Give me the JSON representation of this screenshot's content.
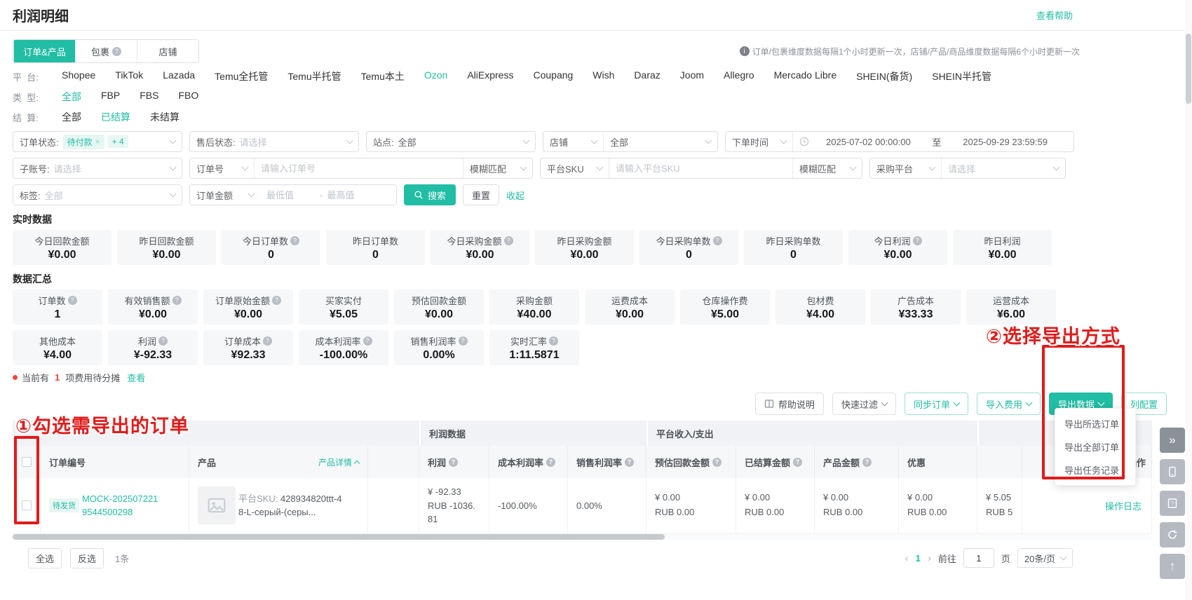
{
  "page": {
    "title": "利润明细",
    "help_link": "查看帮助",
    "update_note": "订单/包裹维度数据每隔1个小时更新一次，店铺/产品/商品维度数据每隔6个小时更新一次"
  },
  "tabs": [
    {
      "label": "订单&产品",
      "active": true
    },
    {
      "label": "包裹",
      "active": false,
      "info": true
    },
    {
      "label": "店铺",
      "active": false
    }
  ],
  "platform_filter": {
    "label": "平  台:",
    "items": [
      {
        "label": "Shopee"
      },
      {
        "label": "TikTok"
      },
      {
        "label": "Lazada"
      },
      {
        "label": "Temu全托管"
      },
      {
        "label": "Temu半托管"
      },
      {
        "label": "Temu本土"
      },
      {
        "label": "Ozon",
        "active": true
      },
      {
        "label": "AliExpress"
      },
      {
        "label": "Coupang"
      },
      {
        "label": "Wish"
      },
      {
        "label": "Daraz"
      },
      {
        "label": "Joom"
      },
      {
        "label": "Allegro"
      },
      {
        "label": "Mercado Libre"
      },
      {
        "label": "SHEIN(备货)"
      },
      {
        "label": "SHEIN半托管"
      }
    ]
  },
  "type_filter": {
    "label": "类  型:",
    "items": [
      {
        "label": "全部",
        "active": true
      },
      {
        "label": "FBP"
      },
      {
        "label": "FBS"
      },
      {
        "label": "FBO"
      }
    ]
  },
  "settle_filter": {
    "label": "结  算:",
    "items": [
      {
        "label": "全部"
      },
      {
        "label": "已结算",
        "active": true
      },
      {
        "label": "未结算"
      }
    ]
  },
  "filters": {
    "order_status": {
      "label": "订单状态:",
      "tag": "待付款",
      "tag_close": "×",
      "more": "+ 4"
    },
    "after_sale": {
      "label": "售后状态:",
      "placeholder": "请选择"
    },
    "site": {
      "label": "站点:",
      "value": "全部"
    },
    "shop": {
      "left": "店铺",
      "value": "全部"
    },
    "order_time": {
      "left": "下单时间",
      "start": "2025-07-02 00:00:00",
      "to": "至",
      "end": "2025-09-29 23:59:59"
    },
    "sub_account": {
      "label": "子账号:",
      "placeholder": "请选择"
    },
    "order_no": {
      "left": "订单号",
      "placeholder": "请输入订单号",
      "match": "模糊匹配"
    },
    "platform_sku": {
      "left": "平台SKU",
      "placeholder": "请输入平台SKU",
      "match": "模糊匹配"
    },
    "purchase_platform": {
      "left": "采购平台",
      "placeholder": "请选择"
    },
    "tag": {
      "label": "标签:",
      "value": "全部"
    },
    "order_amount": {
      "left": "订单金额",
      "min_placeholder": "最低值",
      "dash": "-",
      "max_placeholder": "最高值"
    },
    "search_btn": "搜索",
    "reset_btn": "重置",
    "collapse_link": "收起"
  },
  "realtime": {
    "title": "实时数据",
    "cards": [
      {
        "label": "今日回款金额",
        "value": "¥0.00"
      },
      {
        "label": "昨日回款金额",
        "value": "¥0.00"
      },
      {
        "label": "今日订单数",
        "value": "0",
        "info": true
      },
      {
        "label": "昨日订单数",
        "value": "0"
      },
      {
        "label": "今日采购金额",
        "value": "¥0.00",
        "info": true
      },
      {
        "label": "昨日采购金额",
        "value": "¥0.00"
      },
      {
        "label": "今日采购单数",
        "value": "0",
        "info": true
      },
      {
        "label": "昨日采购单数",
        "value": "0"
      },
      {
        "label": "今日利润",
        "value": "¥0.00",
        "info": true
      },
      {
        "label": "昨日利润",
        "value": "¥0.00"
      }
    ]
  },
  "summary": {
    "title": "数据汇总",
    "row1": [
      {
        "label": "订单数",
        "value": "1",
        "info": true
      },
      {
        "label": "有效销售额",
        "value": "¥0.00",
        "info": true
      },
      {
        "label": "订单原始金额",
        "value": "¥0.00",
        "info": true
      },
      {
        "label": "买家实付",
        "value": "¥5.05"
      },
      {
        "label": "预估回款金额",
        "value": "¥0.00"
      },
      {
        "label": "采购金额",
        "value": "¥40.00"
      },
      {
        "label": "运费成本",
        "value": "¥0.00"
      },
      {
        "label": "仓库操作费",
        "value": "¥5.00"
      },
      {
        "label": "包材费",
        "value": "¥4.00"
      },
      {
        "label": "广告成本",
        "value": "¥33.33"
      },
      {
        "label": "运营成本",
        "value": "¥6.00"
      }
    ],
    "row2": [
      {
        "label": "其他成本",
        "value": "¥4.00"
      },
      {
        "label": "利润",
        "value": "¥-92.33",
        "info": true
      },
      {
        "label": "订单成本",
        "value": "¥92.33",
        "info": true
      },
      {
        "label": "成本利润率",
        "value": "-100.00%",
        "info": true
      },
      {
        "label": "销售利润率",
        "value": "0.00%",
        "info": true
      },
      {
        "label": "实时汇率",
        "value": "1:11.5871",
        "info": true
      }
    ]
  },
  "notice": {
    "prefix": "当前有",
    "count": "1",
    "suffix": "项费用待分摊",
    "link": "查看"
  },
  "toolbar": {
    "help": "帮助说明",
    "quick_filter": "快速过滤",
    "sync_order": "同步订单",
    "import_fee": "导入费用",
    "export_data": "导出数据",
    "column_config": "列配置"
  },
  "export_menu": {
    "items": [
      "导出所选订单",
      "导出全部订单",
      "导出任务记录"
    ]
  },
  "annotations": {
    "step1": "①勾选需导出的订单",
    "step2": "②选择导出方式"
  },
  "table": {
    "groups": {
      "profit": "利润数据",
      "platform": "平台收入/支出"
    },
    "head": {
      "order_no": "订单编号",
      "product": "产品",
      "product_detail": "产品详情",
      "profit": "利润",
      "cost_margin": "成本利润率",
      "sales_margin": "销售利润率",
      "est_payment": "预估回款金额",
      "settled": "已结算金额",
      "product_amount": "产品金额",
      "discount": "优惠",
      "action": "操作"
    },
    "row": {
      "status": "待发货",
      "order_no_line1": "MOCK-202507221",
      "order_no_line2": "9544500298",
      "sku_label": "平台SKU:",
      "sku_value": "428934820ttt-48-L-серый-(серы...",
      "profit_cny": "¥ -92.33",
      "profit_rub": "RUB -1036.81",
      "cost_margin": "-100.00%",
      "sales_margin": "0.00%",
      "est_cny": "¥ 0.00",
      "est_rub": "RUB 0.00",
      "settled_cny": "¥ 0.00",
      "settled_rub": "RUB 0.00",
      "amount_cny": "¥ 0.00",
      "amount_rub": "RUB 0.00",
      "discount_cny": "¥ 0.00",
      "discount_rub": "RUB 0.00",
      "partial_cny": "¥ 5.05",
      "partial_rub": "RUB 5",
      "action": "操作日志"
    }
  },
  "footer": {
    "select_all": "全选",
    "invert": "反选",
    "count": "1条",
    "prev": "‹",
    "page": "1",
    "next": "›",
    "goto": "前往",
    "goto_value": "1",
    "page_label": "页",
    "page_size": "20条/页"
  }
}
